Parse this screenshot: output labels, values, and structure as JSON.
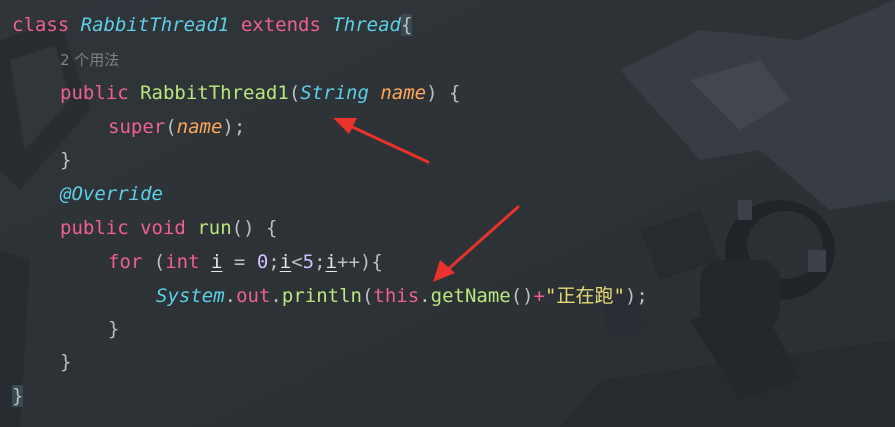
{
  "editor": {
    "lines": [
      {
        "kw_class": "class",
        "class_name": "RabbitThread1",
        "kw_extends": "extends",
        "super_class": "Thread",
        "brace": "{"
      },
      {
        "usages": "2 个用法"
      },
      {
        "kw_public": "public",
        "ctor_name": "RabbitThread1",
        "lp": "(",
        "param_type": "String",
        "param_name": "name",
        "rp": ")",
        "brace": "{"
      },
      {
        "kw_super": "super",
        "lp": "(",
        "arg": "name",
        "rp": ")",
        "semi": ";"
      },
      {
        "brace": "}"
      },
      {
        "annotation": "@Override"
      },
      {
        "kw_public": "public",
        "kw_void": "void",
        "method_name": "run",
        "parens": "()",
        "brace": "{"
      },
      {
        "kw_for": "for",
        "lp": "(",
        "kw_int": "int",
        "var_i": "i",
        "eq": "=",
        "zero": "0",
        "semi": ";",
        "cmp": "<",
        "five": "5",
        "inc": "++",
        "rp": ")",
        "brace": "{"
      },
      {
        "system": "System",
        "dot": ".",
        "out": "out",
        "println": "println",
        "lp": "(",
        "kw_this": "this",
        "get_name": "getName",
        "call": "()",
        "plus": "+",
        "string": "\"正在跑\"",
        "rp": ")",
        "semi": ";"
      },
      {
        "brace": "}"
      },
      {
        "brace": "}"
      },
      {
        "brace": "}"
      }
    ]
  }
}
